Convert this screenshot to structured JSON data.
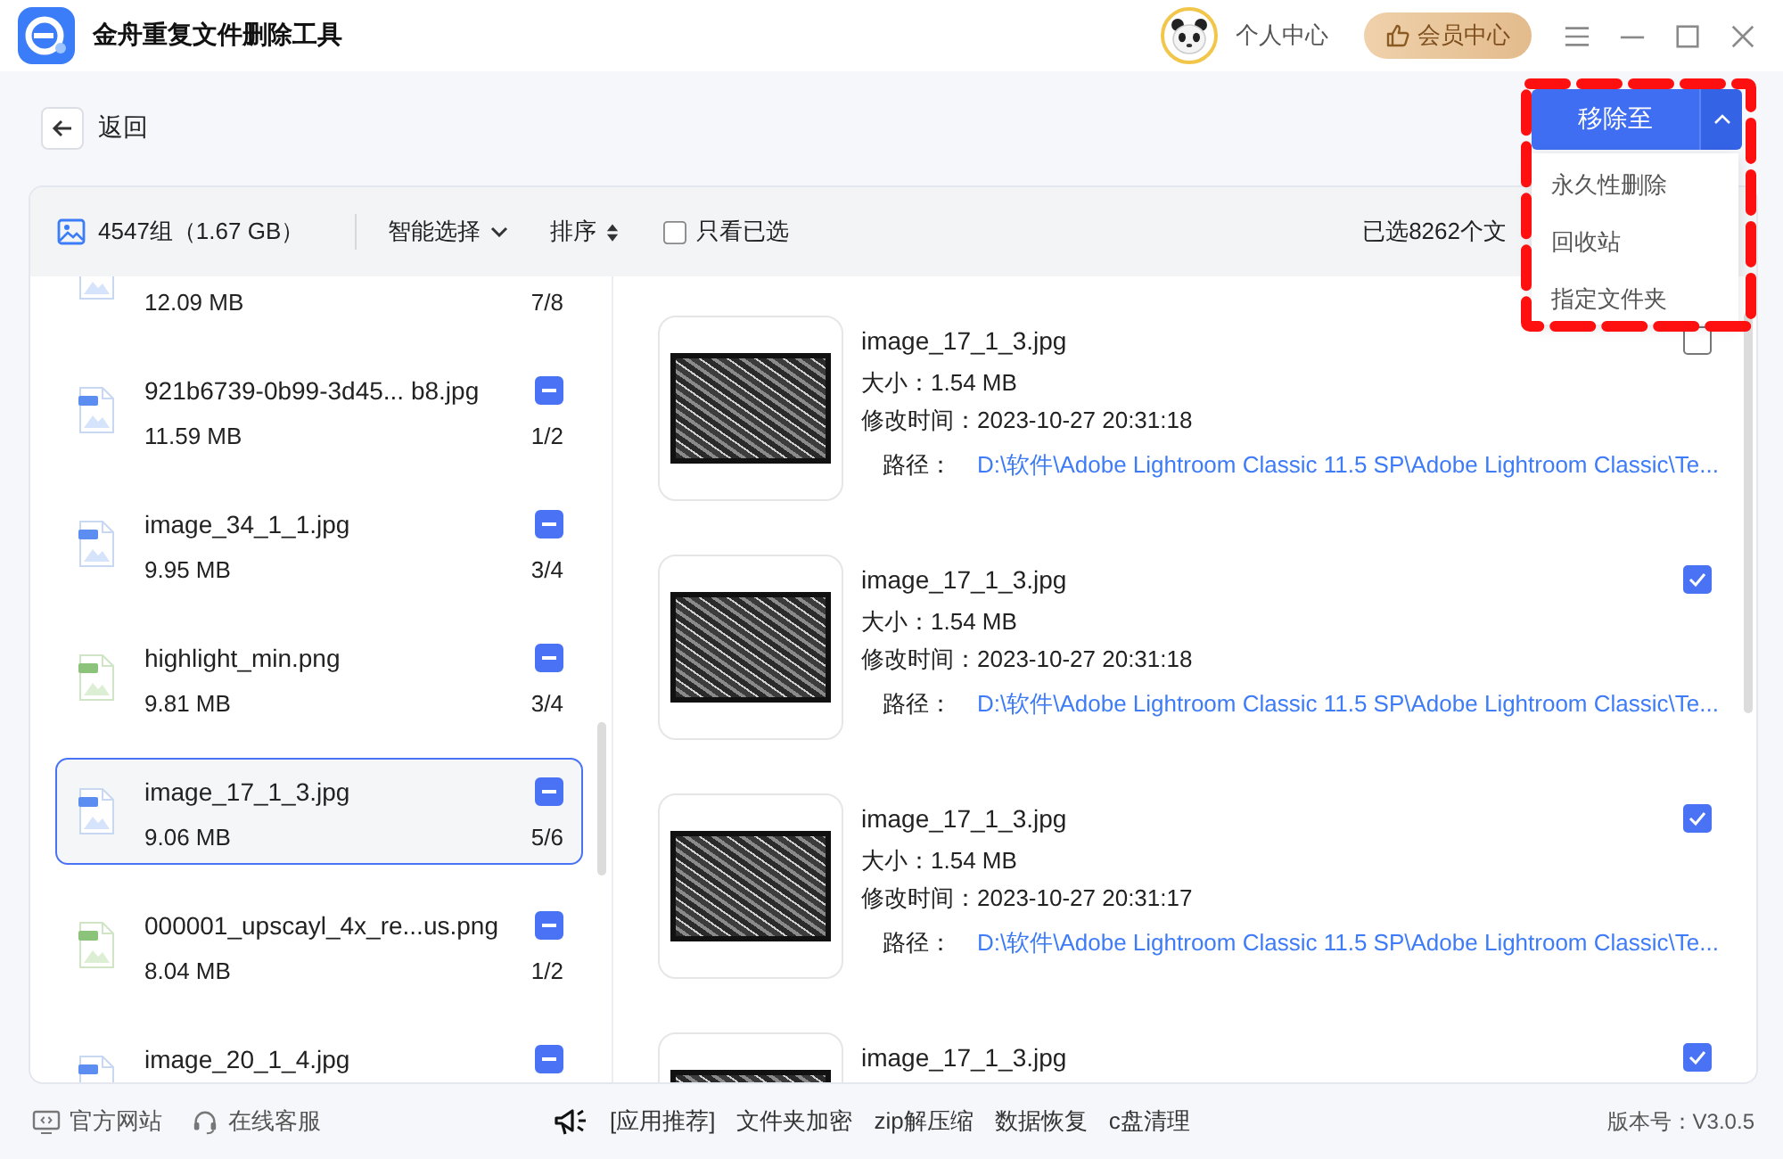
{
  "window": {
    "title": "金舟重复文件删除工具",
    "user": "个人中心",
    "vip": "会员中心"
  },
  "toolbar": {
    "back": "返回",
    "move_button": {
      "label": "移除至",
      "expanded": true,
      "options": [
        "永久性删除",
        "回收站",
        "指定文件夹"
      ]
    }
  },
  "filter_bar": {
    "summary": "4547组（1.67 GB）",
    "smart_select": "智能选择",
    "sort": "排序",
    "only_selected": {
      "label": "只看已选",
      "checked": false
    },
    "selected_count": "已选8262个文"
  },
  "groups": [
    {
      "kind": "jpg",
      "size": "12.09 MB",
      "count": "7/8",
      "selected": false
    },
    {
      "kind": "jpg",
      "name": "921b6739-0b99-3d45... b8.jpg",
      "size": "11.59 MB",
      "count": "1/2",
      "partially_checked": true,
      "selected": false
    },
    {
      "kind": "jpg",
      "name": "image_34_1_1.jpg",
      "size": "9.95 MB",
      "count": "3/4",
      "partially_checked": true,
      "selected": false
    },
    {
      "kind": "png",
      "name": "highlight_min.png",
      "size": "9.81 MB",
      "count": "3/4",
      "partially_checked": true,
      "selected": false
    },
    {
      "kind": "jpg",
      "name": "image_17_1_3.jpg",
      "size": "9.06 MB",
      "count": "5/6",
      "partially_checked": true,
      "selected": true
    },
    {
      "kind": "png",
      "name": "000001_upscayl_4x_re...us.png",
      "size": "8.04 MB",
      "count": "1/2",
      "partially_checked": true,
      "selected": false
    },
    {
      "kind": "jpg",
      "name": "image_20_1_4.jpg",
      "partially_checked": true,
      "selected": false
    }
  ],
  "files": [
    {
      "name": "image_17_1_3.jpg",
      "size": "大小：1.54 MB",
      "modified": "修改时间：2023-10-27 20:31:18",
      "path_label": "路径：",
      "path": "D:\\软件\\Adobe Lightroom Classic 11.5 SP\\Adobe Lightroom Classic\\Te...",
      "checked": false
    },
    {
      "name": "image_17_1_3.jpg",
      "size": "大小：1.54 MB",
      "modified": "修改时间：2023-10-27 20:31:18",
      "path_label": "路径：",
      "path": "D:\\软件\\Adobe Lightroom Classic 11.5 SP\\Adobe Lightroom Classic\\Te...",
      "checked": true
    },
    {
      "name": "image_17_1_3.jpg",
      "size": "大小：1.54 MB",
      "modified": "修改时间：2023-10-27 20:31:17",
      "path_label": "路径：",
      "path": "D:\\软件\\Adobe Lightroom Classic 11.5 SP\\Adobe Lightroom Classic\\Te...",
      "checked": true
    },
    {
      "name": "image_17_1_3.jpg",
      "checked": true
    }
  ],
  "footer": {
    "links": [
      {
        "kind": "website",
        "label": "官方网站"
      },
      {
        "kind": "support",
        "label": "在线客服"
      }
    ],
    "promo_label": "[应用推荐]",
    "promos": [
      "文件夹加密",
      "zip解压缩",
      "数据恢复",
      "c盘清理"
    ],
    "version": "版本号：V3.0.5"
  }
}
